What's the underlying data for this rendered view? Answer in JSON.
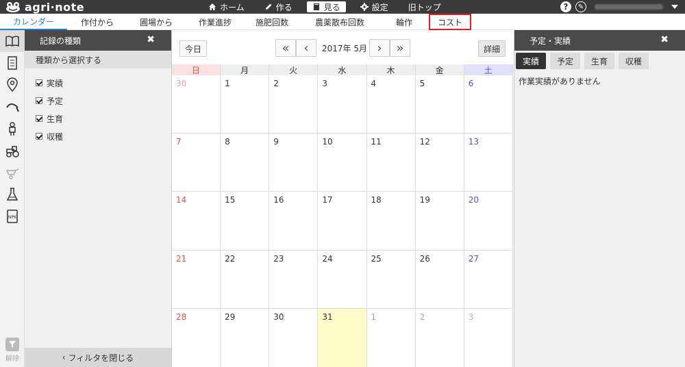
{
  "app": {
    "logo_text": "agri·note"
  },
  "topnav": {
    "items": [
      {
        "label": "ホーム",
        "icon": "home-icon"
      },
      {
        "label": "作る",
        "icon": "pencil-icon"
      },
      {
        "label": "見る",
        "icon": "book-icon",
        "active": true
      },
      {
        "label": "設定",
        "icon": "gear-icon"
      },
      {
        "label": "旧トップ",
        "icon": ""
      }
    ],
    "help": "?",
    "pen": "✎"
  },
  "tabs": [
    {
      "label": "カレンダー",
      "active": true
    },
    {
      "label": "作付から"
    },
    {
      "label": "圃場から"
    },
    {
      "label": "作業進捗"
    },
    {
      "label": "施肥回数"
    },
    {
      "label": "農薬散布回数"
    },
    {
      "label": "輪作"
    },
    {
      "label": "コスト",
      "highlight": true
    }
  ],
  "rail": {
    "icons": [
      "book-open-icon",
      "document-icon",
      "map-pin-icon",
      "sickle-icon",
      "worker-icon",
      "tractor-icon",
      "wheelbarrow-icon",
      "flask-icon",
      "npk-fertilizer-icon"
    ],
    "bottom_label": "解除"
  },
  "filter": {
    "title": "記録の種類",
    "close": "✖",
    "subtitle": "種類から選択する",
    "items": [
      "実績",
      "予定",
      "生育",
      "収穫"
    ],
    "footer": "フィルタを閉じる"
  },
  "calendar": {
    "today_button": "今日",
    "month_label": "2017年 5月",
    "detail_button": "詳細",
    "weekdays": [
      "日",
      "月",
      "火",
      "水",
      "木",
      "金",
      "土"
    ],
    "weeks": [
      [
        "30",
        "1",
        "2",
        "3",
        "4",
        "5",
        "6"
      ],
      [
        "7",
        "8",
        "9",
        "10",
        "11",
        "12",
        "13"
      ],
      [
        "14",
        "15",
        "16",
        "17",
        "18",
        "19",
        "20"
      ],
      [
        "21",
        "22",
        "23",
        "24",
        "25",
        "26",
        "27"
      ],
      [
        "28",
        "29",
        "30",
        "31",
        "1",
        "2",
        "3"
      ]
    ]
  },
  "right_panel": {
    "title": "予定・実績",
    "close": "✖",
    "tabs": [
      "実績",
      "予定",
      "生育",
      "収穫"
    ],
    "empty_message": "作業実績がありません"
  }
}
